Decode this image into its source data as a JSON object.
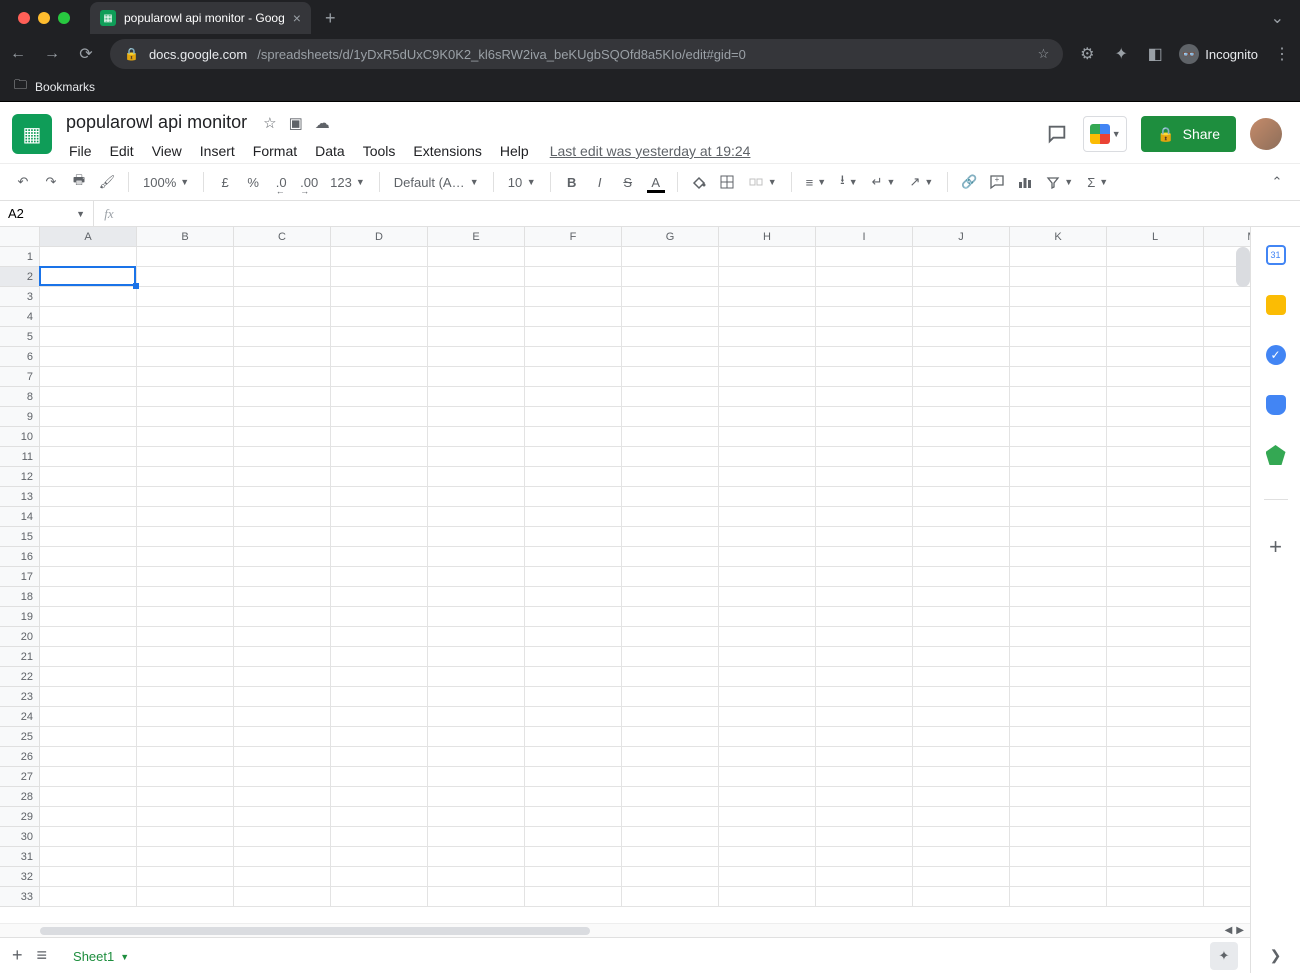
{
  "browser": {
    "tab_title": "popularowl api monitor - Goog",
    "url_host": "docs.google.com",
    "url_path": "/spreadsheets/d/1yDxR5dUxC9K0K2_kl6sRW2iva_beKUgbSQOfd8a5KIo/edit#gid=0",
    "incognito_label": "Incognito",
    "bookmarks_label": "Bookmarks"
  },
  "doc": {
    "title": "popularowl api monitor",
    "last_edit": "Last edit was yesterday at 19:24",
    "share_label": "Share"
  },
  "menus": [
    "File",
    "Edit",
    "View",
    "Insert",
    "Format",
    "Data",
    "Tools",
    "Extensions",
    "Help"
  ],
  "toolbar": {
    "zoom": "100%",
    "currency": "£",
    "percent": "%",
    "dec_dec": ".0",
    "inc_dec": ".00",
    "numfmt": "123",
    "font": "Default (Ari...",
    "font_size": "10"
  },
  "name_box": "A2",
  "columns": [
    "A",
    "B",
    "C",
    "D",
    "E",
    "F",
    "G",
    "H",
    "I",
    "J",
    "K",
    "L",
    "M"
  ],
  "rows": [
    1,
    2,
    3,
    4,
    5,
    6,
    7,
    8,
    9,
    10,
    11,
    12,
    13,
    14,
    15,
    16,
    17,
    18,
    19,
    20,
    21,
    22,
    23,
    24,
    25,
    26,
    27,
    28,
    29,
    30,
    31,
    32,
    33
  ],
  "selected": {
    "col": "A",
    "row": 2,
    "col_index": 0,
    "row_index": 1
  },
  "sheet_tab": "Sheet1",
  "side_calendar_day": "31"
}
